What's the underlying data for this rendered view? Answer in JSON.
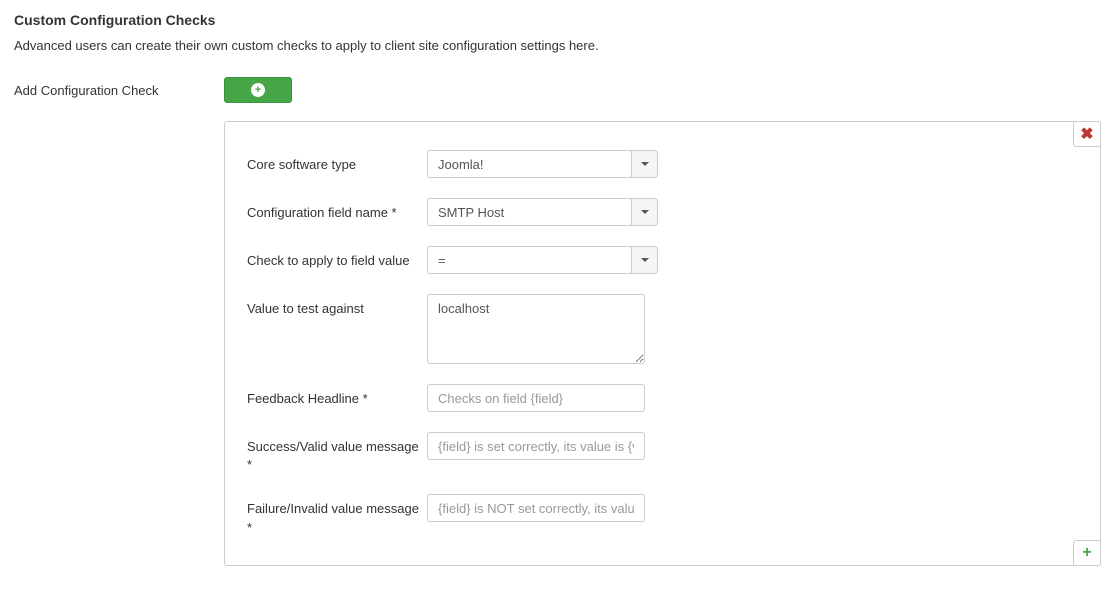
{
  "header": {
    "title": "Custom Configuration Checks",
    "subtitle": "Advanced users can create their own custom checks to apply to client site configuration settings here."
  },
  "add": {
    "label": "Add Configuration Check"
  },
  "form": {
    "core_software_type": {
      "label": "Core software type",
      "value": "Joomla!"
    },
    "config_field_name": {
      "label": "Configuration field name *",
      "value": "SMTP Host"
    },
    "check_to_apply": {
      "label": "Check to apply to field value",
      "value": "="
    },
    "value_to_test": {
      "label": "Value to test against",
      "value": "localhost"
    },
    "feedback_headline": {
      "label": "Feedback Headline *",
      "placeholder": "Checks on field {field}",
      "value": ""
    },
    "success_message": {
      "label": "Success/Valid value message *",
      "placeholder": "{field} is set correctly, its value is {value}",
      "value": ""
    },
    "failure_message": {
      "label": "Failure/Invalid value message *",
      "placeholder": "{field} is NOT set correctly, its value is {value}",
      "value": ""
    }
  }
}
